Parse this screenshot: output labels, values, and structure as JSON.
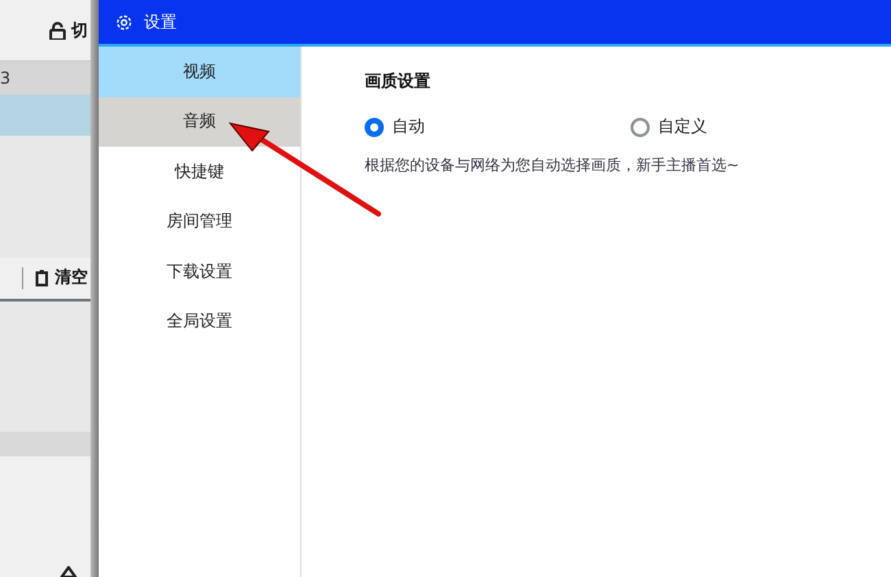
{
  "background_app": {
    "toolbar_button": "切",
    "row_label": "3",
    "clear_button": "清空"
  },
  "window": {
    "title": "设置"
  },
  "sidebar": {
    "items": [
      {
        "label": "视频",
        "selected": true,
        "hovered": false
      },
      {
        "label": "音频",
        "selected": false,
        "hovered": true
      },
      {
        "label": "快捷键",
        "selected": false,
        "hovered": false
      },
      {
        "label": "房间管理",
        "selected": false,
        "hovered": false
      },
      {
        "label": "下载设置",
        "selected": false,
        "hovered": false
      },
      {
        "label": "全局设置",
        "selected": false,
        "hovered": false
      }
    ]
  },
  "content": {
    "section_title": "画质设置",
    "options": [
      {
        "label": "自动",
        "selected": true
      },
      {
        "label": "自定义",
        "selected": false
      }
    ],
    "description": "根据您的设备与网络为您自动选择画质，新手主播首选~"
  }
}
